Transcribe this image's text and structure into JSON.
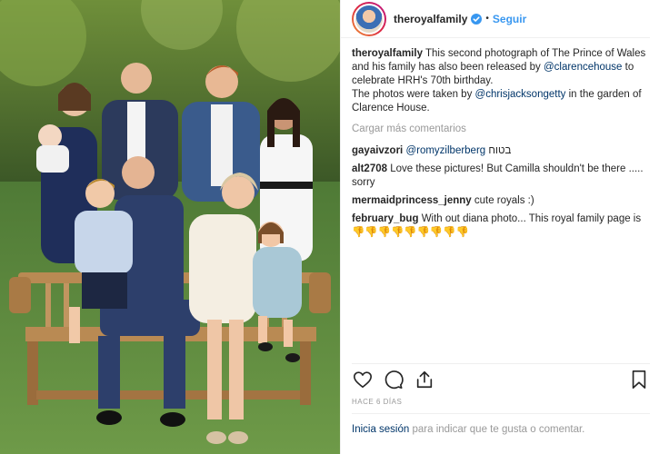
{
  "post": {
    "photo_alt": "",
    "account": {
      "username": "theroyalfamily",
      "verified": true,
      "separator": "•",
      "follow_label": "Seguir"
    },
    "caption": {
      "username": "theroyalfamily",
      "text_1": " This second photograph of The Prince of Wales and his family has also been released by ",
      "mention_1": "@clarencehouse",
      "text_2": " to celebrate HRH's 70th birthday.",
      "text_3": "The photos were taken by ",
      "mention_2": "@chrisjacksongetty",
      "text_4": " in the garden of Clarence House."
    },
    "load_more_label": "Cargar más comentarios",
    "comments": [
      {
        "username": "gayaivzori",
        "mention": "@romyzilberberg",
        "text": " בטוח"
      },
      {
        "username": "alt2708",
        "mention": "",
        "text": " Love these pictures! But Camilla shouldn't be there ..... sorry"
      },
      {
        "username": "mermaidprincess_jenny",
        "mention": "",
        "text": " cute royals :)"
      },
      {
        "username": "february_bug",
        "mention": "",
        "text": " With out diana photo... This royal family page is 👎👎👎👎👎👎👎👎👎"
      }
    ],
    "actions": {
      "like_icon": "heart-icon",
      "comment_icon": "comment-bubble-icon",
      "share_icon": "share-icon",
      "save_icon": "bookmark-icon"
    },
    "timestamp": "HACE 6 DÍAS",
    "login_prompt": {
      "link": "Inicia sesión",
      "text": " para indicar que te gusta o comentar."
    },
    "colors": {
      "link_blue": "#3897f0",
      "mention": "#003569",
      "muted": "#999999"
    }
  }
}
